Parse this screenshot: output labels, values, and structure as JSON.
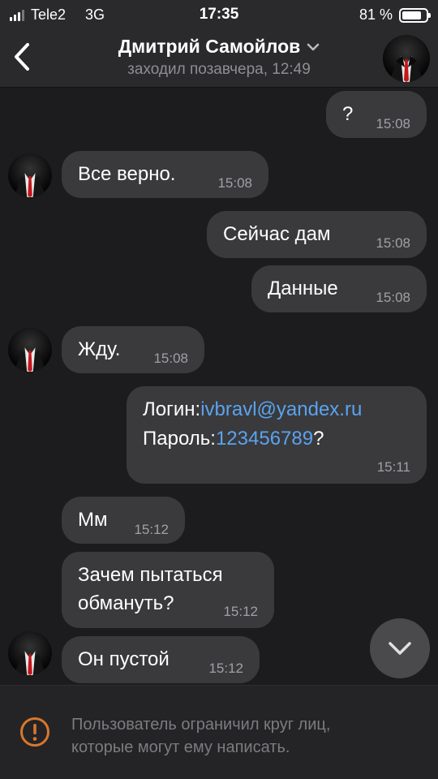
{
  "status_bar": {
    "carrier": "Tele2",
    "network": "3G",
    "time": "17:35",
    "battery_text": "81 %",
    "battery_level": 0.81,
    "signal_bars_active": 3
  },
  "header": {
    "name": "Дмитрий Самойлов",
    "last_seen": "заходил позавчера, 12:49"
  },
  "messages": [
    {
      "from": "me",
      "text": "?",
      "time": "15:08"
    },
    {
      "from": "contact",
      "text": "Все верно.",
      "time": "15:08",
      "avatar": true
    },
    {
      "from": "me",
      "text": "Сейчас дам",
      "time": "15:08"
    },
    {
      "from": "me",
      "text": "Данные",
      "time": "15:08"
    },
    {
      "from": "contact",
      "text": "Жду.",
      "time": "15:08",
      "avatar": true
    },
    {
      "from": "me",
      "login_label": "Логин:",
      "login_value": "ivbravl@yandex.ru",
      "password_label": "Пароль:",
      "password_value": "123456789",
      "password_suffix": "?",
      "time": "15:11"
    },
    {
      "from": "contact",
      "text": "Мм",
      "time": "15:12"
    },
    {
      "from": "contact",
      "line1": "Зачем пытаться",
      "line2": "обмануть?",
      "time": "15:12"
    },
    {
      "from": "contact",
      "text": "Он пустой",
      "time": "15:12",
      "avatar": true
    }
  ],
  "footer": {
    "line1": "Пользователь ограничил круг лиц,",
    "line2": "которые могут ему написать."
  },
  "icons": {
    "back": "chevron-left-icon",
    "name_dropdown": "chevron-down-icon",
    "scroll_down": "chevron-down-icon",
    "warning": "exclamation-circle-icon"
  },
  "colors": {
    "background": "#1c1c1e",
    "bubble": "#3a3a3c",
    "link": "#5aa3f0",
    "warning": "#d9772b",
    "secondary_text": "#8e8e93"
  }
}
